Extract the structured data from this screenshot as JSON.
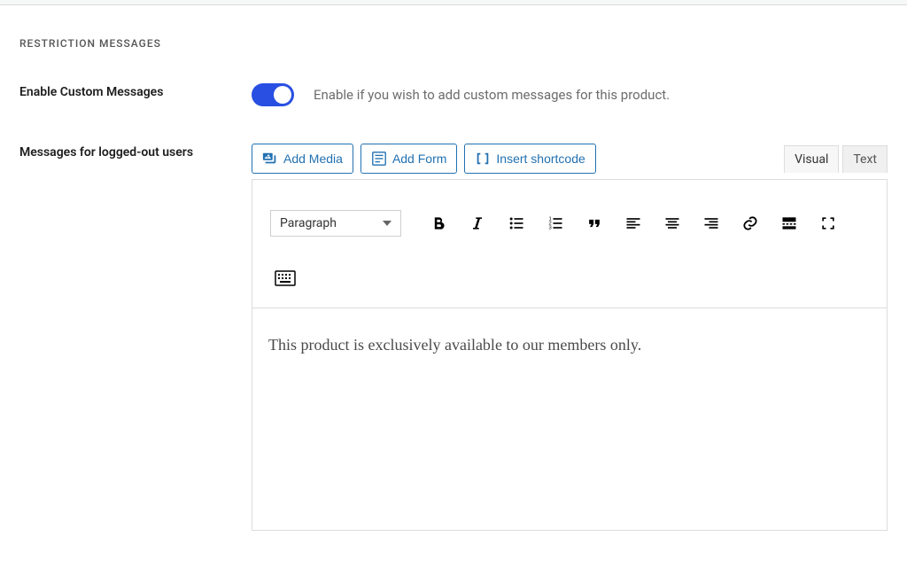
{
  "section_title": "RESTRICTION MESSAGES",
  "fields": {
    "enable_custom": {
      "label": "Enable Custom Messages",
      "description": "Enable if you wish to add custom messages for this product.",
      "value": true
    },
    "logged_out": {
      "label": "Messages for logged-out users"
    }
  },
  "editor": {
    "buttons": {
      "add_media": "Add Media",
      "add_form": "Add Form",
      "insert_shortcode": "Insert shortcode"
    },
    "tabs": {
      "visual": "Visual",
      "text": "Text",
      "active": "visual"
    },
    "format_select": "Paragraph",
    "content": "This product is exclusively available to our members only."
  }
}
